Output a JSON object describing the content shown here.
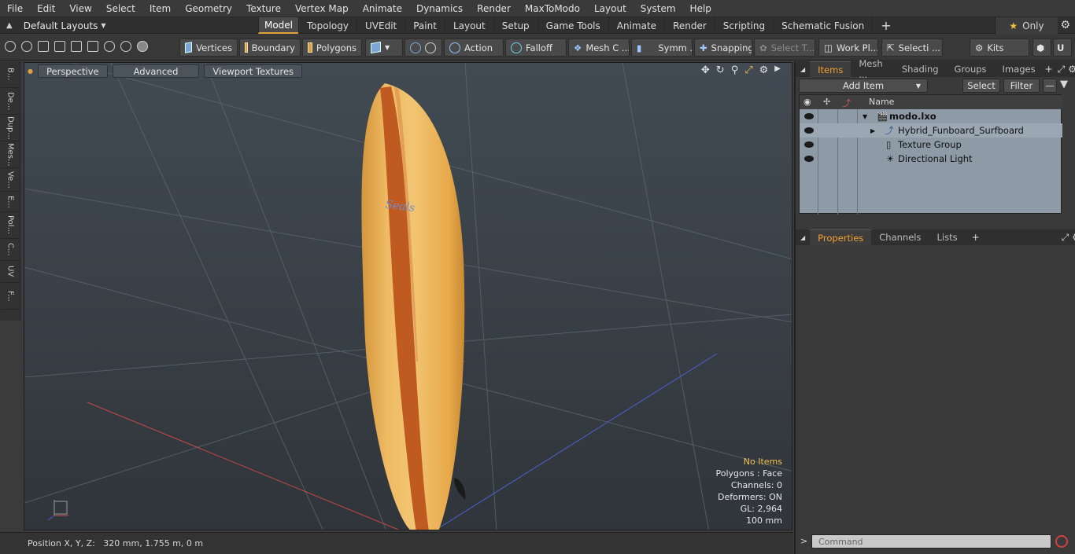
{
  "menu": [
    "File",
    "Edit",
    "View",
    "Select",
    "Item",
    "Geometry",
    "Texture",
    "Vertex Map",
    "Animate",
    "Dynamics",
    "Render",
    "MaxToModo",
    "Layout",
    "System",
    "Help"
  ],
  "layout_selector": "Default Layouts",
  "tabs": [
    "Model",
    "Topology",
    "UVEdit",
    "Paint",
    "Layout",
    "Setup",
    "Game Tools",
    "Animate",
    "Render",
    "Scripting",
    "Schematic Fusion"
  ],
  "active_tab": "Model",
  "only_label": "Only",
  "toolbar": {
    "vertices": "Vertices",
    "boundary": "Boundary",
    "polygons": "Polygons",
    "action": "Action",
    "falloff": "Falloff",
    "meshc": "Mesh C ...",
    "symm": "Symm ...",
    "snapping": "Snapping",
    "select_t": "Select T...",
    "work_pl": "Work Pl...",
    "selecti": "Selecti ...",
    "kits": "Kits"
  },
  "left_tabs": [
    "B...",
    "De...",
    "Dup...",
    "Mes...",
    "Ve...",
    "E...",
    "Pol...",
    "C...",
    "UV",
    "F..."
  ],
  "viewport": {
    "perspective": "Perspective",
    "advanced": "Advanced",
    "viewport_textures": "Viewport Textures",
    "logo_text": "Seals",
    "stats": {
      "no_items": "No Items",
      "polygons": "Polygons : Face",
      "channels": "Channels: 0",
      "deformers": "Deformers: ON",
      "gl": "GL: 2,964",
      "scale": "100 mm"
    }
  },
  "status": "Position X, Y, Z:   320 mm, 1.755 m, 0 m",
  "right_panel": {
    "tabs": [
      "Items",
      "Mesh ...",
      "Shading",
      "Groups",
      "Images"
    ],
    "add_item": "Add Item",
    "select": "Select",
    "filter": "Filter",
    "name_header": "Name",
    "items": [
      {
        "name": "modo.lxo",
        "bold": true
      },
      {
        "name": "Hybrid_Funboard_Surfboard",
        "bold": false
      },
      {
        "name": "Texture Group",
        "bold": false
      },
      {
        "name": "Directional Light",
        "bold": false
      }
    ],
    "prop_tabs": [
      "Properties",
      "Channels",
      "Lists"
    ],
    "command_placeholder": "Command"
  }
}
